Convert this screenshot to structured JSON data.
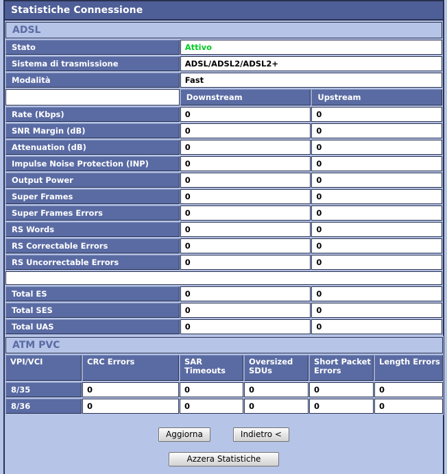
{
  "window": {
    "title": "Statistiche Connessione"
  },
  "colors": {
    "titlebar_bg": "#4e5e97",
    "label_bg": "#5a6ba3",
    "page_bg": "#b6c4e8",
    "border": "#28304e",
    "status_active": "#00cc22"
  },
  "adsl": {
    "section_title": "ADSL",
    "info_rows": [
      {
        "label": "Stato",
        "value": "Attivo",
        "state": "green"
      },
      {
        "label": "Sistema di trasmissione",
        "value": "ADSL/ADSL2/ADSL2+",
        "state": "plain"
      },
      {
        "label": "Modalità",
        "value": "Fast",
        "state": "plain"
      }
    ],
    "columns": {
      "blank": "",
      "downstream": "Downstream",
      "upstream": "Upstream"
    },
    "stat_rows": [
      {
        "label": "Rate (Kbps)",
        "down": "0",
        "up": "0"
      },
      {
        "label": "SNR Margin (dB)",
        "down": "0",
        "up": "0"
      },
      {
        "label": "Attenuation (dB)",
        "down": "0",
        "up": "0"
      },
      {
        "label": "Impulse Noise Protection (INP)",
        "down": "0",
        "up": "0"
      },
      {
        "label": "Output Power",
        "down": "0",
        "up": "0"
      },
      {
        "label": "Super Frames",
        "down": "0",
        "up": "0"
      },
      {
        "label": "Super Frames Errors",
        "down": "0",
        "up": "0"
      },
      {
        "label": "RS Words",
        "down": "0",
        "up": "0"
      },
      {
        "label": "RS Correctable Errors",
        "down": "0",
        "up": "0"
      },
      {
        "label": "RS Uncorrectable Errors",
        "down": "0",
        "up": "0"
      }
    ],
    "total_rows": [
      {
        "label": "Total ES",
        "down": "0",
        "up": "0"
      },
      {
        "label": "Total SES",
        "down": "0",
        "up": "0"
      },
      {
        "label": "Total UAS",
        "down": "0",
        "up": "0"
      }
    ]
  },
  "atm_pvc": {
    "section_title": "ATM PVC",
    "headers": [
      "VPI/VCI",
      "CRC Errors",
      "SAR Timeouts",
      "Oversized SDUs",
      "Short Packet Errors",
      "Length Errors"
    ],
    "rows": [
      {
        "vpivci": "8/35",
        "crc_errors": "0",
        "sar_timeouts": "0",
        "oversized_sdus": "0",
        "short_packet_errors": "0",
        "length_errors": "0"
      },
      {
        "vpivci": "8/36",
        "crc_errors": "0",
        "sar_timeouts": "0",
        "oversized_sdus": "0",
        "short_packet_errors": "0",
        "length_errors": "0"
      }
    ]
  },
  "buttons": {
    "refresh": "Aggiorna",
    "back": "Indietro <",
    "reset": "Azzera Statistiche"
  }
}
